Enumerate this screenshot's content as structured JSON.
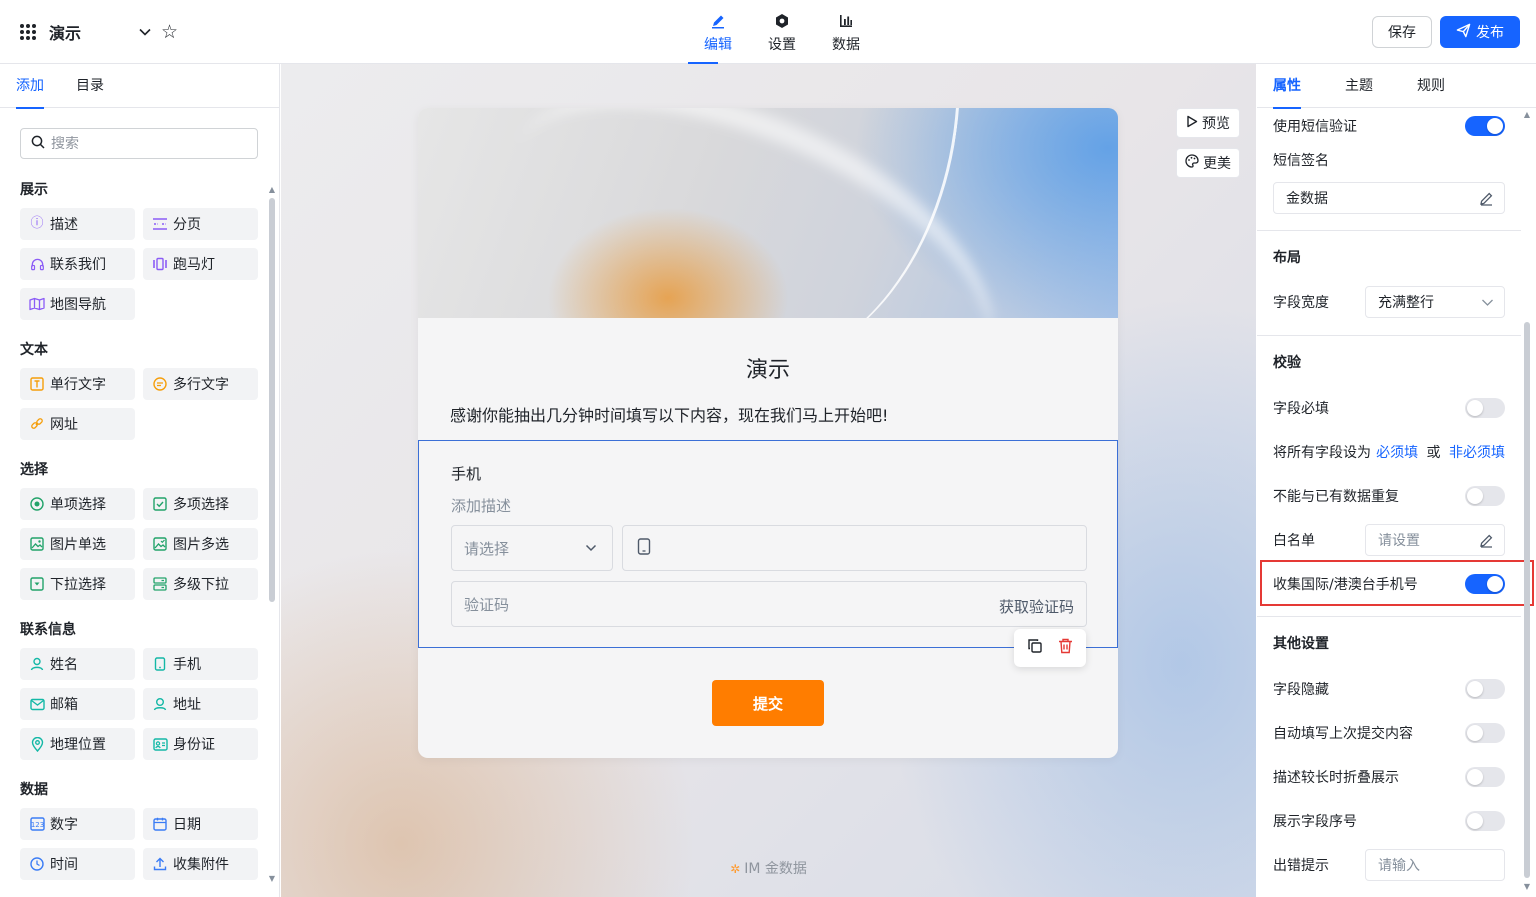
{
  "app": {
    "title": "演示"
  },
  "top_tabs": [
    {
      "label": "编辑",
      "icon": "edit-icon",
      "active": true
    },
    {
      "label": "设置",
      "icon": "settings-icon",
      "active": false
    },
    {
      "label": "数据",
      "icon": "chart-icon",
      "active": false
    }
  ],
  "actions": {
    "save": "保存",
    "publish": "发布"
  },
  "left": {
    "tabs": [
      "添加",
      "目录"
    ],
    "search_placeholder": "搜索",
    "groups": [
      {
        "title": "展示",
        "items": [
          {
            "label": "描述",
            "icon": "info-icon"
          },
          {
            "label": "分页",
            "icon": "pagination-icon"
          },
          {
            "label": "联系我们",
            "icon": "headset-icon"
          },
          {
            "label": "跑马灯",
            "icon": "carousel-icon"
          },
          {
            "label": "地图导航",
            "icon": "map-icon"
          }
        ]
      },
      {
        "title": "文本",
        "items": [
          {
            "label": "单行文字",
            "icon": "text-input-icon"
          },
          {
            "label": "多行文字",
            "icon": "multiline-icon"
          },
          {
            "label": "网址",
            "icon": "link-icon"
          }
        ]
      },
      {
        "title": "选择",
        "items": [
          {
            "label": "单项选择",
            "icon": "radio-icon"
          },
          {
            "label": "多项选择",
            "icon": "checkbox-icon"
          },
          {
            "label": "图片单选",
            "icon": "image-radio-icon"
          },
          {
            "label": "图片多选",
            "icon": "image-checkbox-icon"
          },
          {
            "label": "下拉选择",
            "icon": "dropdown-icon"
          },
          {
            "label": "多级下拉",
            "icon": "cascade-icon"
          }
        ]
      },
      {
        "title": "联系信息",
        "items": [
          {
            "label": "姓名",
            "icon": "user-icon"
          },
          {
            "label": "手机",
            "icon": "phone-icon"
          },
          {
            "label": "邮箱",
            "icon": "mail-icon"
          },
          {
            "label": "地址",
            "icon": "address-icon"
          },
          {
            "label": "地理位置",
            "icon": "location-icon"
          },
          {
            "label": "身份证",
            "icon": "id-card-icon"
          }
        ]
      },
      {
        "title": "数据",
        "items": [
          {
            "label": "数字",
            "icon": "number-icon"
          },
          {
            "label": "日期",
            "icon": "calendar-icon"
          },
          {
            "label": "时间",
            "icon": "clock-icon"
          },
          {
            "label": "收集附件",
            "icon": "upload-icon"
          }
        ]
      }
    ]
  },
  "canvas": {
    "tools": {
      "preview": "预览",
      "beautify": "更美"
    },
    "form": {
      "title": "演示",
      "description": "感谢你能抽出几分钟时间填写以下内容，现在我们马上开始吧!",
      "field": {
        "label": "手机",
        "desc_placeholder": "添加描述",
        "select_placeholder": "请选择",
        "code_placeholder": "验证码",
        "get_code": "获取验证码"
      },
      "submit": "提交"
    },
    "brand": "IM 金数据"
  },
  "right": {
    "tabs": [
      "属性",
      "主题",
      "规则"
    ],
    "sms_verify": {
      "label": "使用短信验证",
      "on": true
    },
    "sms_sign": {
      "label": "短信签名",
      "value": "金数据"
    },
    "layout": {
      "title": "布局",
      "width_label": "字段宽度",
      "width_value": "充满整行"
    },
    "validation": {
      "title": "校验",
      "required": "字段必填",
      "set_all_prefix": "将所有字段设为",
      "set_required": "必须填",
      "or": "或",
      "set_optional": "非必须填",
      "no_duplicate": "不能与已有数据重复",
      "whitelist": "白名单",
      "whitelist_placeholder": "请设置",
      "intl_phone": "收集国际/港澳台手机号",
      "intl_phone_on": true
    },
    "other": {
      "title": "其他设置",
      "hide": "字段隐藏",
      "autofill": "自动填写上次提交内容",
      "fold": "描述较长时折叠展示",
      "show_index": "展示字段序号",
      "error_hint": "出错提示",
      "error_placeholder": "请输入"
    }
  },
  "colors": {
    "accent": "#1664ff",
    "submit": "#ff7d00",
    "highlight": "#e53935"
  }
}
